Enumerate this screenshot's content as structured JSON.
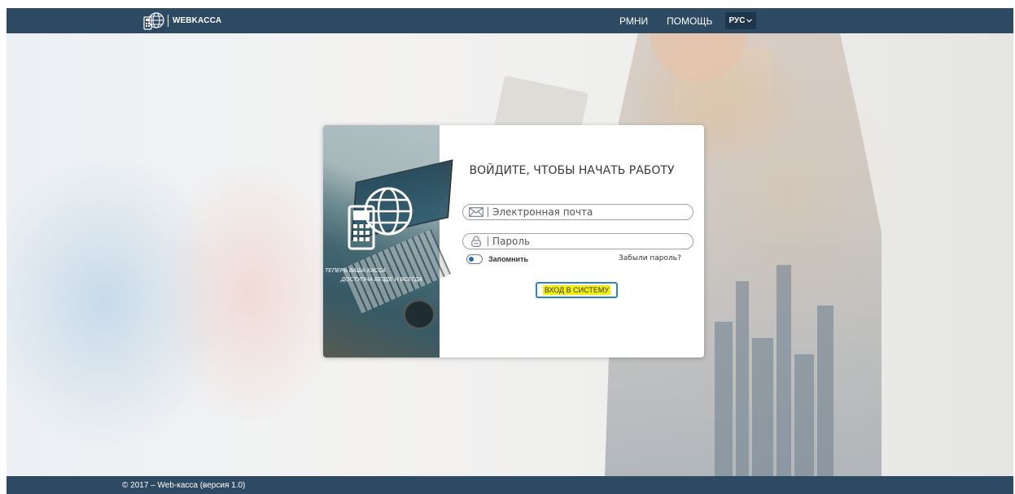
{
  "header": {
    "brand_name": "WEBKACCA",
    "nav": {
      "rmni": "РМНИ",
      "help": "ПОМОЩЬ"
    },
    "language": "РУС"
  },
  "promo": {
    "tagline_line1": "ТЕПЕРЬ ВАША КАССА",
    "tagline_line2": "ДОСТУПНА ВЕЗДЕ И ВСЕГДА"
  },
  "login": {
    "title": "ВОЙДИТЕ, ЧТОБЫ НАЧАТЬ РАБОТУ",
    "email": {
      "placeholder": "Электронная почта",
      "value": "",
      "icon": "envelope-icon"
    },
    "password": {
      "placeholder": "Пароль",
      "value": "",
      "icon": "lock-icon"
    },
    "remember_label": "Запомнить",
    "remember_checked": true,
    "forgot_label": "Забыли пароль?",
    "submit_label": "ВХОД В СИСТЕМУ"
  },
  "footer": {
    "copyright": "© 2017 – Web-касса (версия 1.0)"
  },
  "colors": {
    "bar": "#2e4a63",
    "button_border": "#2a86c0",
    "button_highlight": "#f4f000",
    "toggle_knob": "#1f6fb5"
  }
}
